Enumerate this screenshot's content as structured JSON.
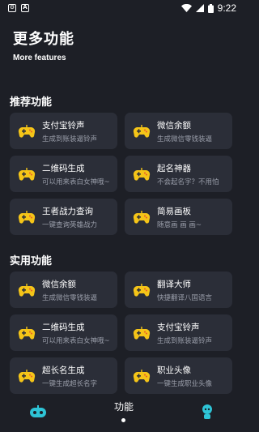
{
  "status_bar": {
    "time": "9:22"
  },
  "header": {
    "title": "更多功能",
    "subtitle": "More features"
  },
  "sections": [
    {
      "title": "推荐功能",
      "items": [
        {
          "name": "支付宝铃声",
          "desc": "生成到账装逼铃声"
        },
        {
          "name": "微信余额",
          "desc": "生成微信零钱装逼"
        },
        {
          "name": "二维码生成",
          "desc": "可以用来表白女神哦~"
        },
        {
          "name": "起名神器",
          "desc": "不会起名字？不用怕"
        },
        {
          "name": "王者战力查询",
          "desc": "一键查询英雄战力"
        },
        {
          "name": "简易画板",
          "desc": "随意画 画 画~"
        }
      ]
    },
    {
      "title": "实用功能",
      "items": [
        {
          "name": "微信余额",
          "desc": "生成微信零钱装逼"
        },
        {
          "name": "翻译大师",
          "desc": "快捷翻译八国语言"
        },
        {
          "name": "二维码生成",
          "desc": "可以用来表白女神哦~"
        },
        {
          "name": "支付宝铃声",
          "desc": "生成到账装逼铃声"
        },
        {
          "name": "超长名生成",
          "desc": "一键生成超长名字"
        },
        {
          "name": "职业头像",
          "desc": "一键生成职业头像"
        }
      ]
    }
  ],
  "tab_bar": {
    "center_label": "功能",
    "left_icon": "gamepad-bot-icon",
    "right_icon": "avatar-bot-icon"
  },
  "colors": {
    "background": "#1d1f26",
    "card": "#2b2e38",
    "gamepad_yellow": "#f5c518",
    "accent_teal": "#2ec4d6"
  }
}
